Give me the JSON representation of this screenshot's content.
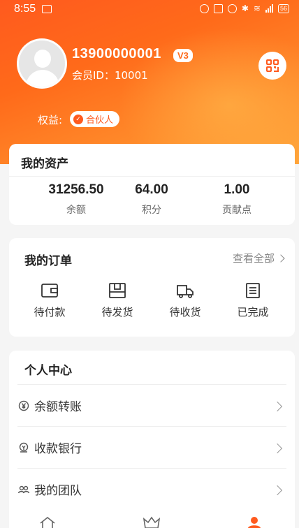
{
  "status_bar": {
    "time": "8:55",
    "battery": "56"
  },
  "profile": {
    "phone": "13900000001",
    "level": "V3",
    "member_id": "会员ID：10001",
    "perk_label": "权益:",
    "perk_badge": "合伙人"
  },
  "assets": {
    "title": "我的资产",
    "stats": [
      {
        "value": "31256.50",
        "label": "余额"
      },
      {
        "value": "64.00",
        "label": "积分"
      },
      {
        "value": "1.00",
        "label": "贡献点"
      }
    ]
  },
  "orders": {
    "title": "我的订单",
    "view_all": "查看全部",
    "items": [
      {
        "label": "待付款",
        "icon": "wallet-icon"
      },
      {
        "label": "待发货",
        "icon": "package-icon"
      },
      {
        "label": "待收货",
        "icon": "truck-icon"
      },
      {
        "label": "已完成",
        "icon": "list-done-icon"
      }
    ]
  },
  "personal_center": {
    "title": "个人中心",
    "items": [
      {
        "label": "余额转账",
        "icon": "yen-circle-icon"
      },
      {
        "label": "收款银行",
        "icon": "bank-icon"
      },
      {
        "label": "我的团队",
        "icon": "team-icon"
      }
    ]
  },
  "colors": {
    "accent": "#ff5a1e",
    "accent_light": "#ffa53a"
  }
}
